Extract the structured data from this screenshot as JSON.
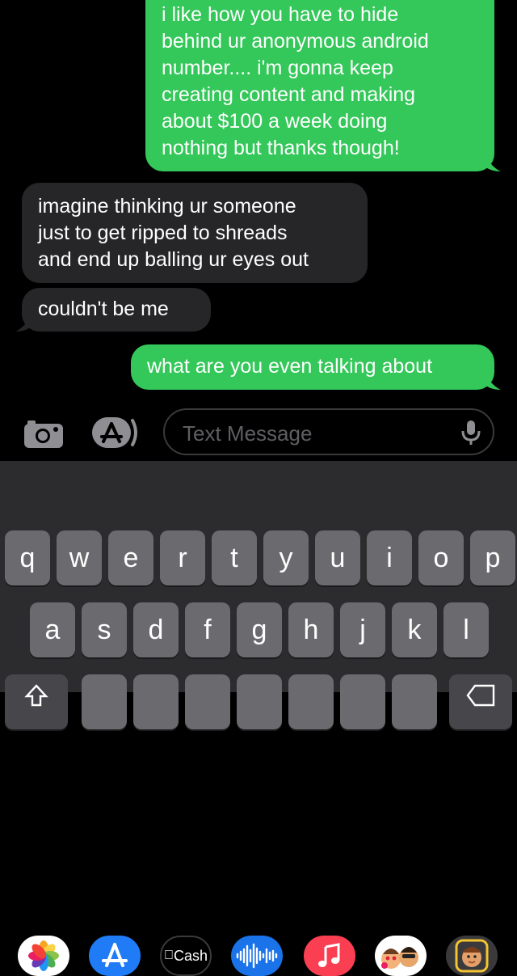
{
  "messages": [
    {
      "id": "m1",
      "direction": "sent",
      "lines": [
        "i like how you have to hide",
        "behind ur anonymous android",
        "number.... i'm gonna keep",
        "creating content and making",
        "about $100 a week doing",
        "nothing but thanks though!"
      ]
    },
    {
      "id": "m2",
      "direction": "received",
      "lines": [
        "imagine thinking ur someone",
        "just to get ripped to shreads",
        "and end up balling ur eyes out"
      ]
    },
    {
      "id": "m3",
      "direction": "received",
      "lines": [
        "couldn't be me"
      ]
    },
    {
      "id": "m4",
      "direction": "sent",
      "lines": [
        "what are you even talking about"
      ]
    }
  ],
  "input": {
    "placeholder": "Text Message",
    "value": ""
  },
  "icons": {
    "camera": "camera-icon",
    "apps": "app-store-icon",
    "mic": "microphone-icon"
  },
  "app_drawer": [
    {
      "name": "photos",
      "label": ""
    },
    {
      "name": "app-store",
      "label": ""
    },
    {
      "name": "apple-cash",
      "label": "Cash"
    },
    {
      "name": "audio-message",
      "label": ""
    },
    {
      "name": "music",
      "label": ""
    },
    {
      "name": "memoji-stickers",
      "label": ""
    },
    {
      "name": "memoji",
      "label": ""
    }
  ],
  "keyboard": {
    "row1": [
      "q",
      "w",
      "e",
      "r",
      "t",
      "y",
      "u",
      "i",
      "o",
      "p"
    ],
    "row2": [
      "a",
      "s",
      "d",
      "f",
      "g",
      "h",
      "j",
      "k",
      "l"
    ],
    "row3": [
      "",
      "",
      "",
      "",
      "",
      "",
      "",
      ""
    ]
  },
  "colors": {
    "sent": "#34c759",
    "received": "#262628",
    "background": "#000000",
    "keyboard": "#2c2c2e",
    "key": "#6b6b6f"
  }
}
